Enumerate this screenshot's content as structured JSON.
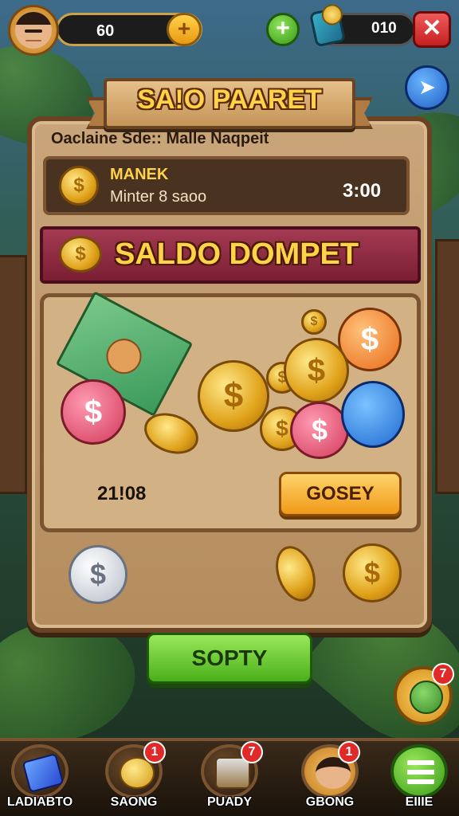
{
  "header": {
    "score": "60",
    "wallet_value": "010",
    "plus_symbol": "+",
    "close_symbol": "✕",
    "share_symbol": "➤"
  },
  "panel": {
    "title": "SA!O PAARET",
    "subtitle": "Oaclaine Sde:: Malle Naqpeit",
    "timer": {
      "line1": "MANEK",
      "line2": "Minter 8 saoo",
      "value": "3:00"
    },
    "saldo_label": "SALDO DOMPET",
    "amount": "21!08",
    "gosey_button": "GOSEY",
    "coin_symbol": "$"
  },
  "primary_button": "SOPTY",
  "pet_badge": "7",
  "nav": [
    {
      "label": "LADIABTO",
      "badge": "",
      "icon": "wallet-icon"
    },
    {
      "label": "SAONG",
      "badge": "1",
      "icon": "coin-stack-icon"
    },
    {
      "label": "PUADY",
      "badge": "7",
      "icon": "chest-icon"
    },
    {
      "label": "GBONG",
      "badge": "1",
      "icon": "profile-icon"
    },
    {
      "label": "EIIIE",
      "badge": "",
      "icon": "menu-icon"
    }
  ],
  "colors": {
    "accent_gold": "#ffd24a",
    "saldo_bar": "#a33a52",
    "primary_green": "#4ab01a",
    "close_red": "#c42020"
  }
}
